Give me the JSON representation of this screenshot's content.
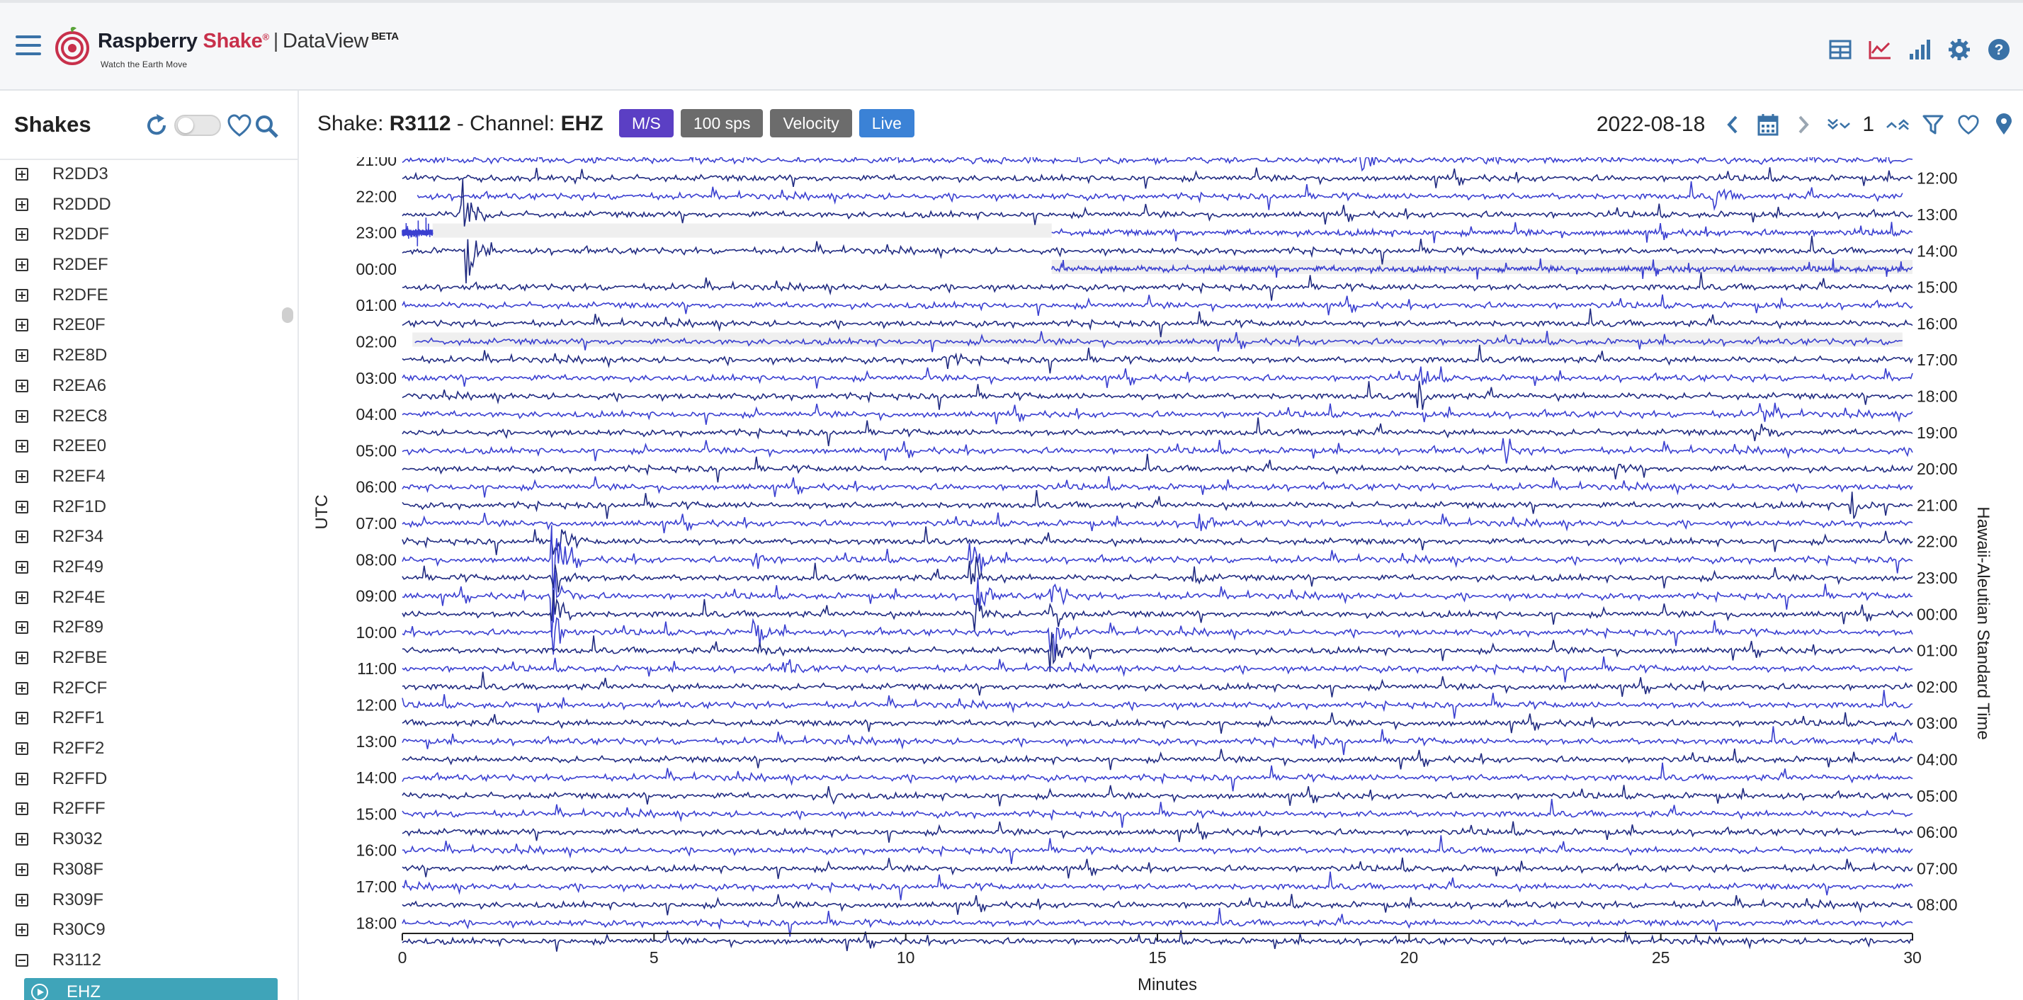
{
  "header": {
    "brand_name": "Raspberry",
    "brand_accent": "Shake",
    "brand_reg": "®",
    "separator": "|",
    "product": "DataView",
    "beta": "BETA",
    "tagline": "Watch the Earth Move",
    "icons": [
      "table-icon",
      "line-chart-icon",
      "bar-chart-icon",
      "gear-icon",
      "help-icon"
    ]
  },
  "sidebar": {
    "title": "Shakes",
    "items": [
      "R2DD3",
      "R2DDD",
      "R2DDF",
      "R2DEF",
      "R2DFE",
      "R2E0F",
      "R2E8D",
      "R2EA6",
      "R2EC8",
      "R2EE0",
      "R2EF4",
      "R2F1D",
      "R2F34",
      "R2F49",
      "R2F4E",
      "R2F89",
      "R2FBE",
      "R2FCF",
      "R2FF1",
      "R2FF2",
      "R2FFD",
      "R2FFF",
      "R3032",
      "R308F",
      "R309F",
      "R30C9"
    ],
    "expanded_item": "R3112",
    "channel": "EHZ"
  },
  "toolbar": {
    "shake_prefix": "Shake:",
    "shake_id": "R3112",
    "channel_prefix": "- Channel:",
    "channel": "EHZ",
    "badges": [
      {
        "label": "M/S",
        "color": "#5b3fc4"
      },
      {
        "label": "100 sps",
        "color": "#6c6c6c"
      },
      {
        "label": "Velocity",
        "color": "#6c6c6c"
      },
      {
        "label": "Live",
        "color": "#3b82d6"
      }
    ],
    "date": "2022-08-18",
    "count": "1"
  },
  "chart_data": {
    "type": "line",
    "title": "",
    "xlabel": "Minutes",
    "xlim": [
      0,
      30
    ],
    "xticks": [
      "0",
      "5",
      "10",
      "15",
      "20",
      "25",
      "30"
    ],
    "ylabel_left": "UTC",
    "ylabel_right": "Hawaii-Aleutian Standard Time",
    "left_hour_labels": [
      "21:00",
      "22:00",
      "23:00",
      "00:00",
      "01:00",
      "02:00",
      "03:00",
      "04:00",
      "05:00",
      "06:00",
      "07:00",
      "08:00",
      "09:00",
      "10:00",
      "11:00",
      "12:00",
      "13:00",
      "14:00",
      "15:00",
      "16:00",
      "17:00",
      "18:00"
    ],
    "right_hour_labels": [
      "12:00",
      "13:00",
      "14:00",
      "15:00",
      "16:00",
      "17:00",
      "18:00",
      "19:00",
      "20:00",
      "21:00",
      "22:00",
      "23:00",
      "00:00",
      "01:00",
      "02:00",
      "03:00",
      "04:00",
      "05:00",
      "06:00",
      "07:00",
      "08:00"
    ],
    "colors": [
      "#3a3fd0",
      "#202a80"
    ]
  }
}
